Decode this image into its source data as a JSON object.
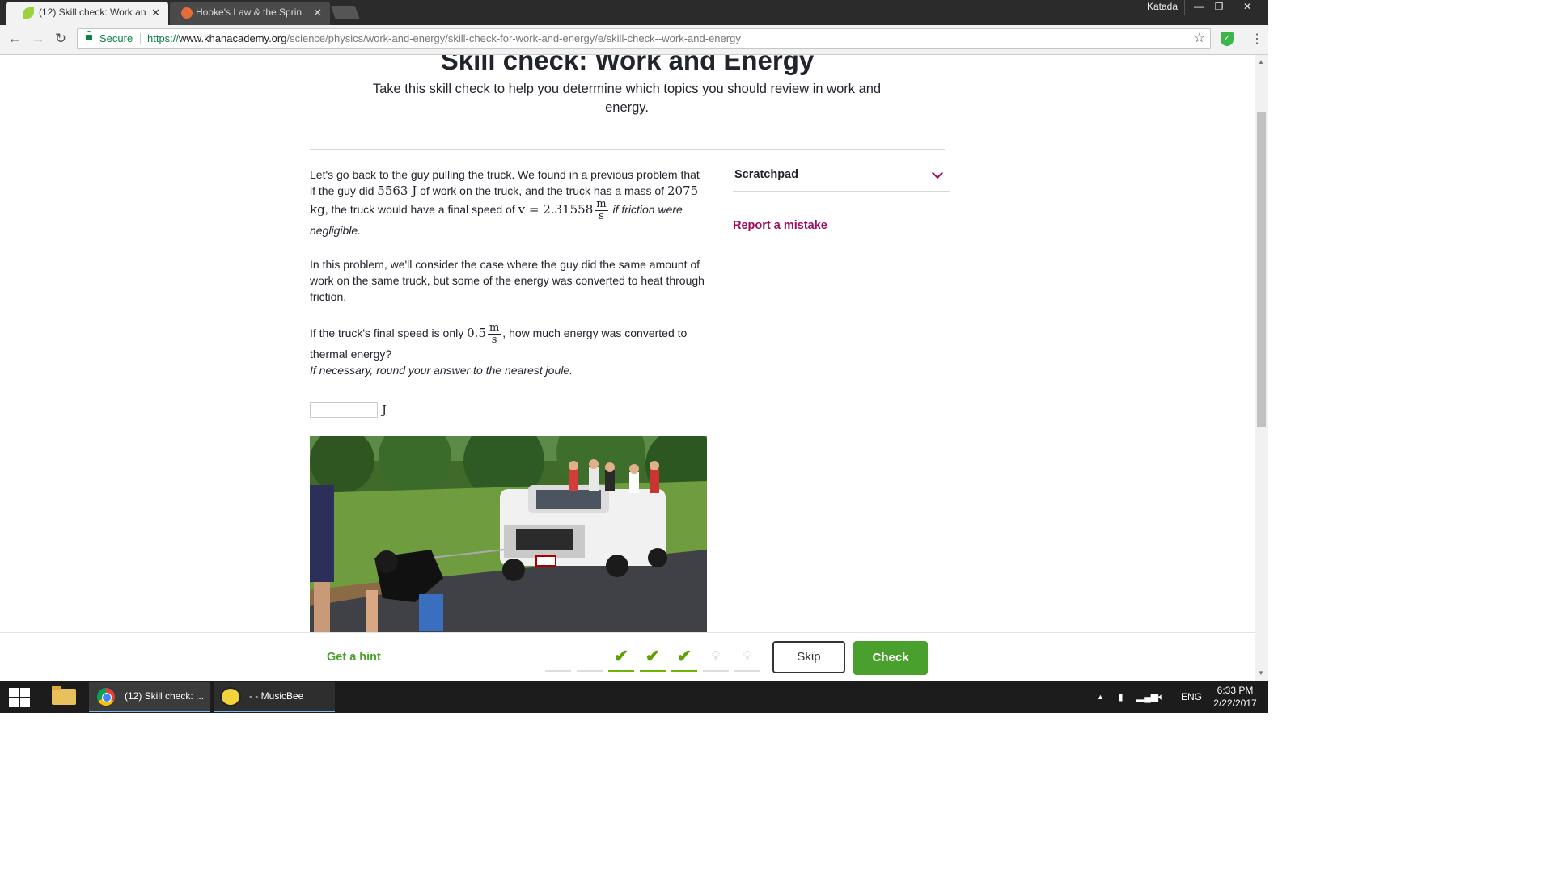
{
  "browser": {
    "tabs": [
      {
        "title": "(12) Skill check: Work an",
        "active": true
      },
      {
        "title": "Hooke's Law & the Sprin",
        "active": false
      }
    ],
    "profile_name": "Katada",
    "security_label": "Secure",
    "url_scheme": "https://",
    "url_host": "www.khanacademy.org",
    "url_path": "/science/physics/work-and-energy/skill-check-for-work-and-energy/e/skill-check--work-and-energy"
  },
  "page": {
    "title": "Skill check: Work and Energy",
    "subtitle": "Take this skill check to help you determine which topics you should review in work and energy.",
    "problem": {
      "p1_a": "Let's go back to the guy pulling the truck. We found in a previous problem that if the guy did ",
      "p1_work": "5563 J",
      "p1_b": " of work on the truck, and the truck has a mass of ",
      "p1_mass": "2075 kg",
      "p1_c": ", the truck would have a final speed of ",
      "p1_speed": "v = 2.31558",
      "p1_unit_num": "m",
      "p1_unit_den": "s",
      "p1_d": " if friction were negligible.",
      "p2": "In this problem, we'll consider the case where the guy did the same amount of work on the same truck, but some of the energy was converted to heat through friction.",
      "p3_a": "If the truck's final speed is only ",
      "p3_speed": "0.5",
      "p3_unit_num": "m",
      "p3_unit_den": "s",
      "p3_b": ", how much energy was converted to thermal energy?",
      "p3_note": "If necessary, round your answer to the nearest joule.",
      "answer_value": "",
      "answer_unit": "J"
    },
    "sidebar": {
      "scratchpad_label": "Scratchpad",
      "report_label": "Report a mistake"
    },
    "footer": {
      "hint_label": "Get a hint",
      "progress": [
        "empty",
        "empty",
        "correct",
        "correct",
        "correct",
        "pending",
        "pending"
      ],
      "skip_label": "Skip",
      "check_label": "Check"
    }
  },
  "taskbar": {
    "apps": [
      {
        "label": "(12) Skill check: ...",
        "icon": "chrome-icon"
      },
      {
        "label": "- - MusicBee",
        "icon": "musicbee-icon"
      }
    ],
    "language": "ENG",
    "time": "6:33 PM",
    "date": "2/22/2017"
  },
  "colors": {
    "khan_green": "#4aa02c",
    "khan_purple": "#9d0c5e",
    "secure_green": "#0b8043"
  }
}
